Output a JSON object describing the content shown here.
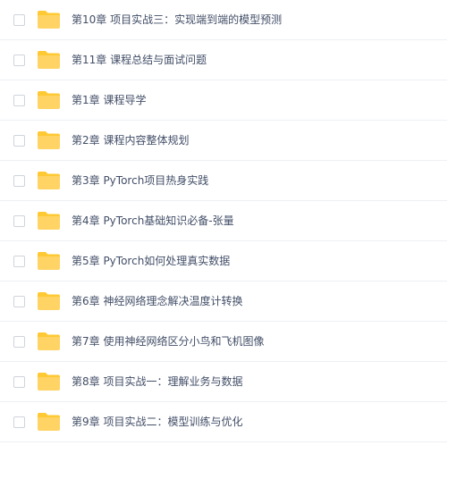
{
  "files": [
    {
      "name": "第10章 项目实战三：实现端到端的模型预测",
      "icon": "folder-icon"
    },
    {
      "name": "第11章 课程总结与面试问题",
      "icon": "folder-icon"
    },
    {
      "name": "第1章 课程导学",
      "icon": "folder-icon"
    },
    {
      "name": "第2章 课程内容整体规划",
      "icon": "folder-icon"
    },
    {
      "name": "第3章 PyTorch项目热身实践",
      "icon": "folder-icon"
    },
    {
      "name": "第4章 PyTorch基础知识必备-张量",
      "icon": "folder-icon"
    },
    {
      "name": "第5章 PyTorch如何处理真实数据",
      "icon": "folder-icon"
    },
    {
      "name": "第6章 神经网络理念解决温度计转换",
      "icon": "folder-icon"
    },
    {
      "name": "第7章 使用神经网络区分小鸟和飞机图像",
      "icon": "folder-icon"
    },
    {
      "name": "第8章 项目实战一：理解业务与数据",
      "icon": "folder-icon"
    },
    {
      "name": "第9章 项目实战二：模型训练与优化",
      "icon": "folder-icon"
    }
  ],
  "colors": {
    "folder_body": "#ffd465",
    "folder_back": "#ffc933",
    "text": "#424e67",
    "divider": "#eef0f4"
  }
}
